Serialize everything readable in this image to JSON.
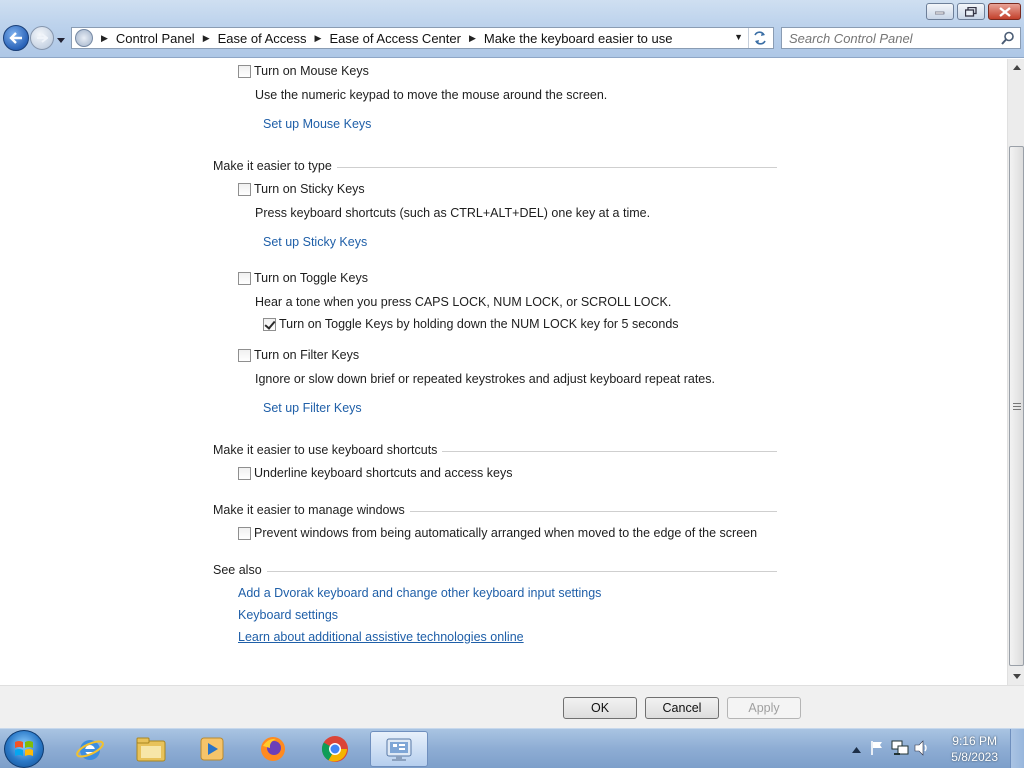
{
  "window": {
    "breadcrumb": [
      "Control Panel",
      "Ease of Access",
      "Ease of Access Center",
      "Make the keyboard easier to use"
    ],
    "search_placeholder": "Search Control Panel"
  },
  "mouse_keys": {
    "checkbox_label": "Turn on Mouse Keys",
    "checked": false,
    "description": "Use the numeric keypad to move the mouse around the screen.",
    "setup_link": "Set up Mouse Keys"
  },
  "type_section": {
    "heading": "Make it easier to type",
    "sticky": {
      "checkbox_label": "Turn on Sticky Keys",
      "checked": false,
      "description": "Press keyboard shortcuts (such as CTRL+ALT+DEL) one key at a time.",
      "setup_link": "Set up Sticky Keys"
    },
    "toggle": {
      "checkbox_label": "Turn on Toggle Keys",
      "checked": false,
      "description": "Hear a tone when you press CAPS LOCK, NUM LOCK, or SCROLL LOCK.",
      "sub_label": "Turn on Toggle Keys by holding down the NUM LOCK key for 5 seconds",
      "sub_checked": true
    },
    "filter": {
      "checkbox_label": "Turn on Filter Keys",
      "checked": false,
      "description": "Ignore or slow down brief or repeated keystrokes and adjust keyboard repeat rates.",
      "setup_link": "Set up Filter Keys"
    }
  },
  "shortcuts_section": {
    "heading": "Make it easier to use keyboard shortcuts",
    "checkbox_label": "Underline keyboard shortcuts and access keys",
    "checked": false
  },
  "windows_section": {
    "heading": "Make it easier to manage windows",
    "checkbox_label": "Prevent windows from being automatically arranged when moved to the edge of the screen",
    "checked": false
  },
  "see_also": {
    "heading": "See also",
    "links": [
      "Add a Dvorak keyboard and change other keyboard input settings",
      "Keyboard settings",
      "Learn about additional assistive technologies online"
    ]
  },
  "buttons": {
    "ok": "OK",
    "cancel": "Cancel",
    "apply": "Apply"
  },
  "taskbar": {
    "apps": [
      "internet-explorer-icon",
      "file-explorer-icon",
      "media-player-icon",
      "firefox-icon",
      "chrome-icon",
      "control-panel-icon"
    ],
    "time": "9:16 PM",
    "date": "5/8/2023"
  }
}
